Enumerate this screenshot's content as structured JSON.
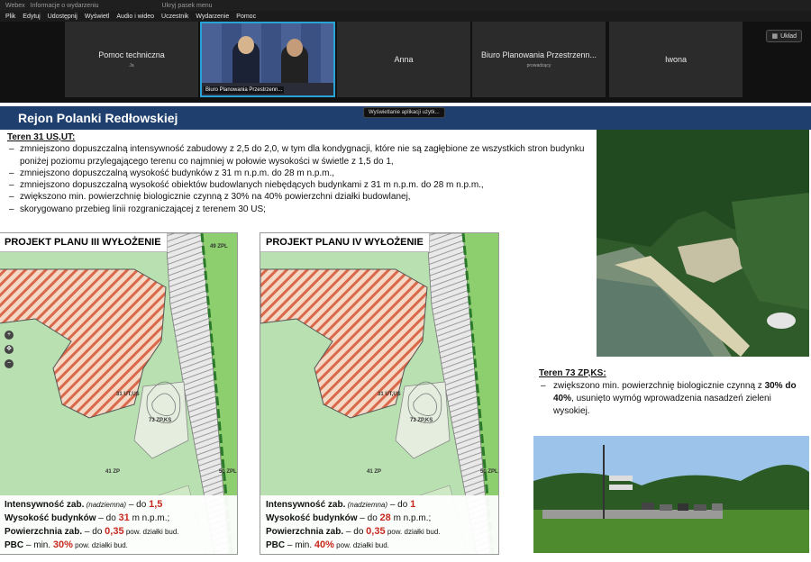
{
  "window": {
    "app_name": "Webex",
    "info_label": "Informacje o wydarzeniu",
    "hide_menu": "Ukryj pasek menu"
  },
  "menu": [
    "Plik",
    "Edytuj",
    "Udostępnij",
    "Wyświetl",
    "Audio i wideo",
    "Uczestnik",
    "Wydarzenie",
    "Pomoc"
  ],
  "participants": [
    {
      "name": "Pomoc techniczna",
      "sub": "Ja"
    },
    {
      "name": "Biuro Planowania Przestrzenn...",
      "active": true
    },
    {
      "name": "Anna"
    },
    {
      "name": "Biuro Planowania Przestrzenn...",
      "sub": "prowadzący"
    },
    {
      "name": "Iwona"
    }
  ],
  "layout_button": "Układ",
  "share_tooltip": "Wyświetlanie aplikacji użytk...",
  "slide": {
    "title": "Rejon Polanki Redłowskiej",
    "teren31": {
      "heading": "Teren 31 US,UT:",
      "items": [
        "zmniejszono dopuszczalną intensywność zabudowy z 2,5 do 2,0, w tym dla kondygnacji, które nie są zagłębione ze wszystkich stron budynku poniżej poziomu przylegającego terenu co najmniej w połowie wysokości w świetle z 1,5 do 1,",
        "zmniejszono dopuszczalną wysokość budynków z 31 m n.p.m. do 28 m n.p.m.,",
        "zmniejszono dopuszczalną wysokość obiektów budowlanych niebędących budynkami z 31 m n.p.m. do 28 m n.p.m.,",
        "zwiększono min. powierzchnię biologicznie czynną z 30% na 40% powierzchni działki budowlanej,",
        "skorygowano przebieg linii rozgraniczającej z terenem 30 US;"
      ]
    },
    "maps": [
      {
        "label": "PROJEKT PLANU  III WYŁOŻENIE",
        "zones": {
          "z1": "49 ZPL",
          "z2": "31 UT,US",
          "z3": "73 ZP,KS",
          "z4": "41 ZP",
          "z5": "50 ZPL"
        },
        "info": {
          "l1_pre": "Intensywność zab.",
          "l1_mid": " (nadziemna)",
          "l1_dash": " – do ",
          "l1_val": "1,5",
          "l2_pre": "Wysokość budynków",
          "l2_dash": " – do ",
          "l2_val": "31",
          "l2_post": " m n.p.m.;",
          "l3_pre": "Powierzchnia zab.",
          "l3_dash": " – do ",
          "l3_val": "0,35",
          "l3_post": " pow. działki bud.",
          "l4_pre": "PBC",
          "l4_dash": " – min. ",
          "l4_val": "30%",
          "l4_post": " pow. działki bud."
        }
      },
      {
        "label": "PROJEKT PLANU  IV WYŁOŻENIE",
        "zones": {
          "z2": "31 UT,US",
          "z3": "73 ZP,KS",
          "z4": "41 ZP",
          "z5": "50 ZPL"
        },
        "info": {
          "l1_pre": "Intensywność zab.",
          "l1_mid": " (nadziemna)",
          "l1_dash": " – do ",
          "l1_val": "1",
          "l2_pre": "Wysokość budynków",
          "l2_dash": " – do ",
          "l2_val": "28",
          "l2_post": " m n.p.m.;",
          "l3_pre": "Powierzchnia zab.",
          "l3_dash": " – do ",
          "l3_val": "0,35",
          "l3_post": " pow. działki bud.",
          "l4_pre": "PBC",
          "l4_dash": " – min. ",
          "l4_val": "40%",
          "l4_post": " pow. działki bud."
        }
      }
    ],
    "teren73": {
      "heading": "Teren 73 ZP,KS:",
      "text_a": "zwiększono min. powierzchnię biologicznie czynną z ",
      "text_b": "30%",
      "text_c": " do 40%",
      "text_d": ", usunięto wymóg wprowadzenia nasadzeń zieleni wysokiej."
    }
  }
}
